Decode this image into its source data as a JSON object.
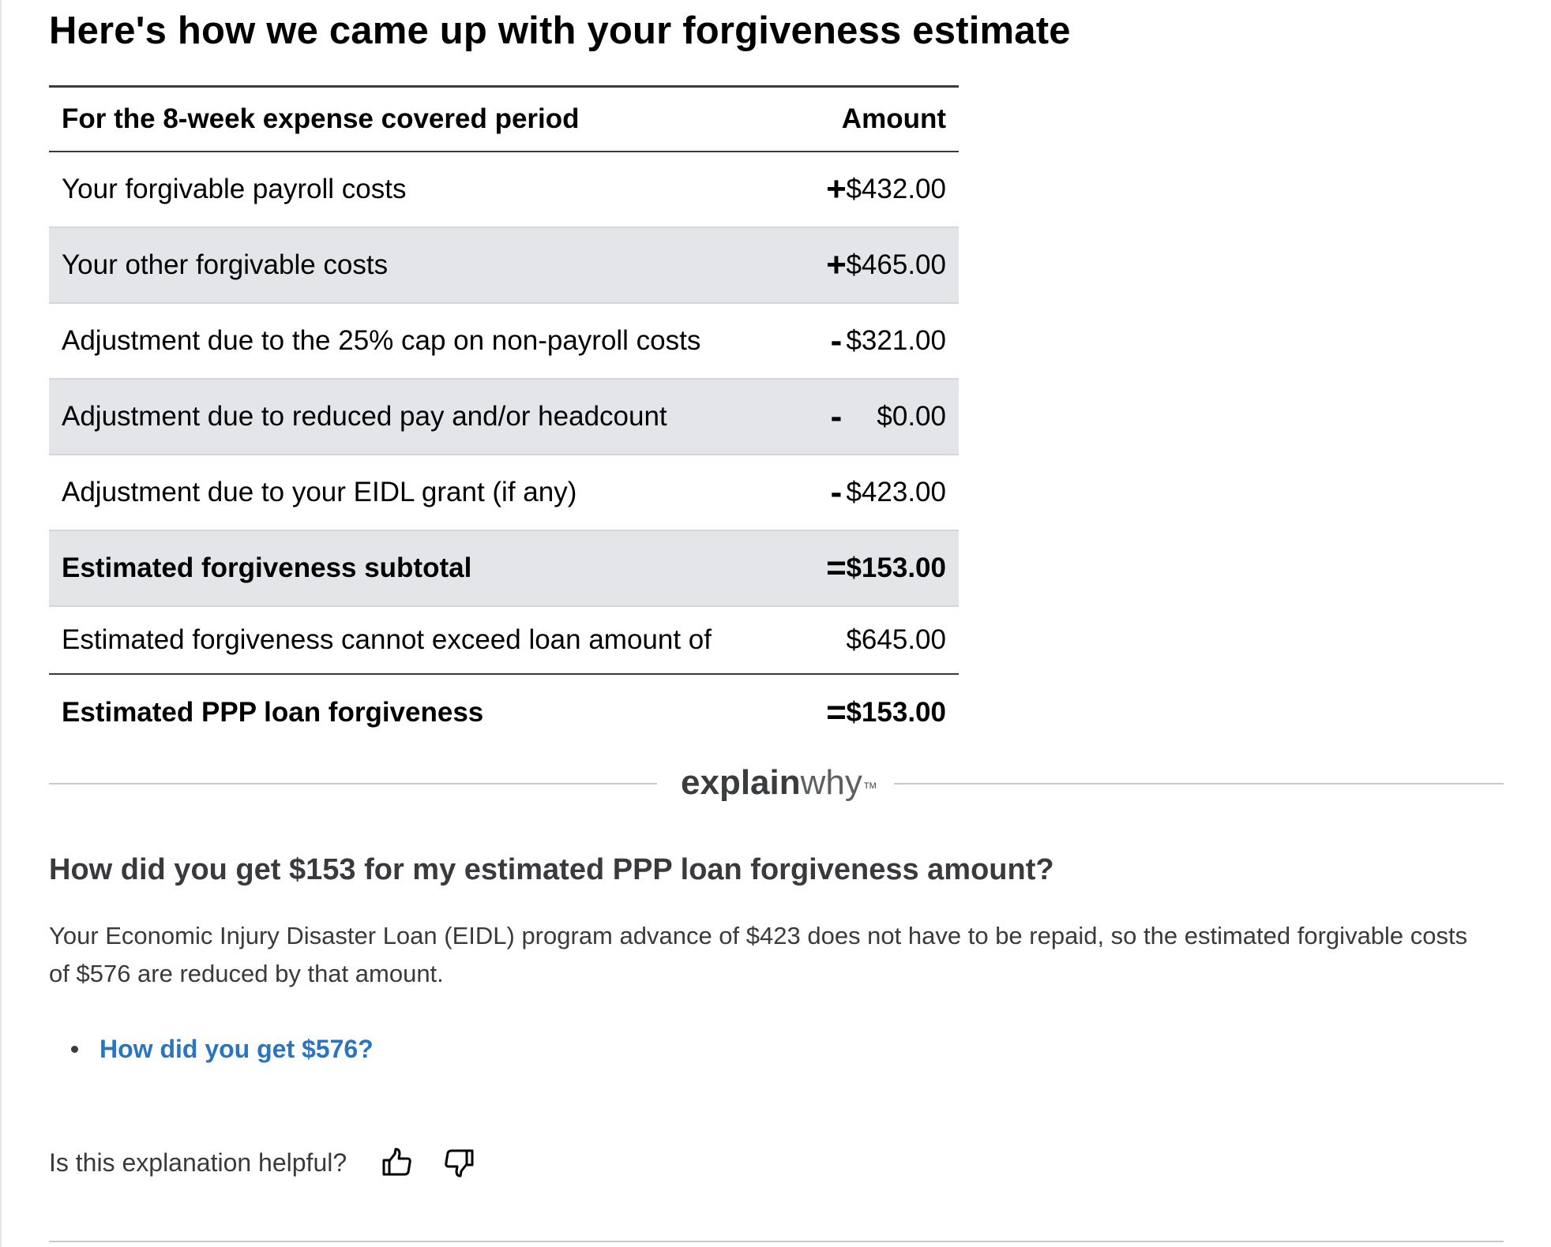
{
  "page": {
    "title": "Here's how we came up with your forgiveness estimate"
  },
  "table": {
    "header": {
      "period_label": "For the 8-week expense covered period",
      "amount_label": "Amount"
    },
    "rows": [
      {
        "label": "Your forgivable payroll costs",
        "operator": "+",
        "amount": "$432.00"
      },
      {
        "label": "Your other forgivable costs",
        "operator": "+",
        "amount": "$465.00"
      },
      {
        "label": "Adjustment due to the 25% cap on non-payroll costs",
        "operator": "-",
        "amount": "$321.00"
      },
      {
        "label": "Adjustment due to reduced pay and/or headcount",
        "operator": "-",
        "amount": "$0.00"
      },
      {
        "label": "Adjustment due to your EIDL grant (if any)",
        "operator": "-",
        "amount": "$423.00"
      },
      {
        "label": "Estimated forgiveness subtotal",
        "operator": "=",
        "amount": "$153.00"
      },
      {
        "label": "Estimated forgiveness cannot exceed loan amount of",
        "operator": "",
        "amount": "$645.00"
      }
    ],
    "total": {
      "label": "Estimated PPP loan forgiveness",
      "operator": "=",
      "amount": "$153.00"
    }
  },
  "explainwhy": {
    "brand_bold": "explain",
    "brand_light": "why",
    "trademark": "TM",
    "question": "How did you get $153 for my estimated PPP loan forgiveness amount?",
    "answer": "Your Economic Injury Disaster Loan (EIDL) program advance of $423 does not have to be repaid, so the estimated forgivable costs of $576 are reduced by that amount.",
    "links": [
      {
        "label": "How did you get $576?"
      }
    ],
    "feedback_prompt": "Is this explanation helpful?",
    "feedback_icons": [
      "thumbs-up-icon",
      "thumbs-down-icon"
    ]
  },
  "colors": {
    "text": "#000000",
    "body_text": "#393a3d",
    "row_shade": "#e3e5e8",
    "link": "#2b74c1",
    "rule": "#393a3d"
  }
}
